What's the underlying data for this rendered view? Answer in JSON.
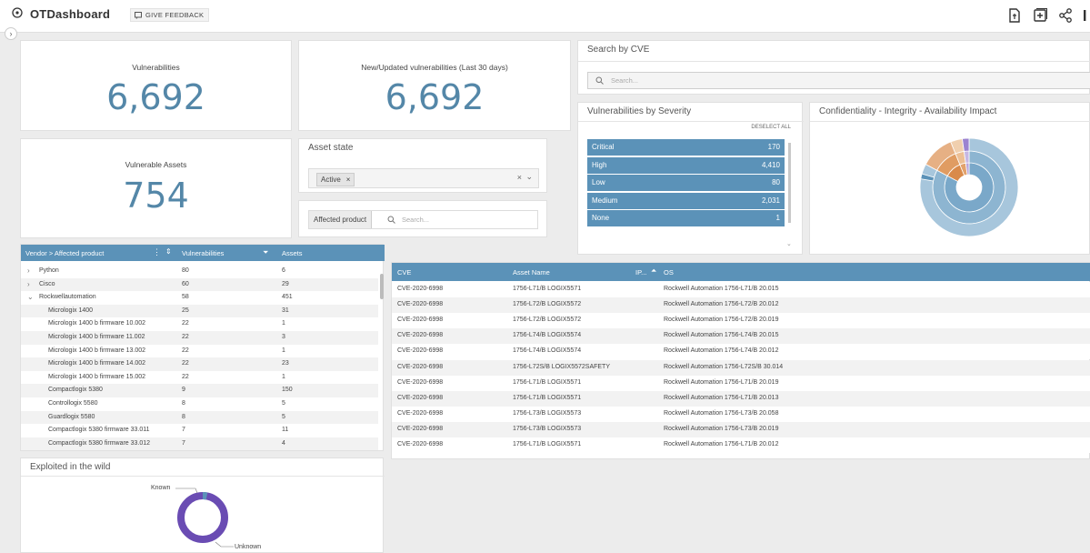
{
  "app": {
    "title": "OTDashboard",
    "feedback_label": "GIVE FEEDBACK"
  },
  "kpis": {
    "vulnerabilities": {
      "label": "Vulnerabilities",
      "value": "6,692"
    },
    "new_updated": {
      "label": "New/Updated vulnerabilities (Last 30 days)",
      "value": "6,692"
    },
    "vulnerable_assets": {
      "label": "Vulnerable Assets",
      "value": "754"
    }
  },
  "asset_state": {
    "title": "Asset state",
    "chip": "Active"
  },
  "affected_product": {
    "label": "Affected product",
    "placeholder": "Search..."
  },
  "search_cve": {
    "title": "Search by CVE",
    "placeholder": "Search..."
  },
  "severity": {
    "title": "Vulnerabilities by Severity",
    "deselect": "DESELECT ALL",
    "rows": [
      {
        "label": "Critical",
        "count": "170"
      },
      {
        "label": "High",
        "count": "4,410"
      },
      {
        "label": "Low",
        "count": "80"
      },
      {
        "label": "Medium",
        "count": "2,031"
      },
      {
        "label": "None",
        "count": "1"
      }
    ]
  },
  "cia": {
    "title": "Confidentiality - Integrity - Availability Impact"
  },
  "vendor_table": {
    "headers": {
      "vendor": "Vendor > Affected product",
      "vulns": "Vulnerabilities",
      "assets": "Assets"
    },
    "rows": [
      {
        "indent": 0,
        "toggle": "›",
        "name": "Python",
        "vulns": "80",
        "assets": "6"
      },
      {
        "indent": 0,
        "toggle": "›",
        "name": "Cisco",
        "vulns": "60",
        "assets": "29"
      },
      {
        "indent": 0,
        "toggle": "⌄",
        "name": "Rockwellautomation",
        "vulns": "58",
        "assets": "451"
      },
      {
        "indent": 1,
        "toggle": "",
        "name": "Micrologix 1400",
        "vulns": "25",
        "assets": "31"
      },
      {
        "indent": 1,
        "toggle": "",
        "name": "Micrologix 1400 b firmware 10.002",
        "vulns": "22",
        "assets": "1"
      },
      {
        "indent": 1,
        "toggle": "",
        "name": "Micrologix 1400 b firmware 11.002",
        "vulns": "22",
        "assets": "3"
      },
      {
        "indent": 1,
        "toggle": "",
        "name": "Micrologix 1400 b firmware 13.002",
        "vulns": "22",
        "assets": "1"
      },
      {
        "indent": 1,
        "toggle": "",
        "name": "Micrologix 1400 b firmware 14.002",
        "vulns": "22",
        "assets": "23"
      },
      {
        "indent": 1,
        "toggle": "",
        "name": "Micrologix 1400 b firmware 15.002",
        "vulns": "22",
        "assets": "1"
      },
      {
        "indent": 1,
        "toggle": "",
        "name": "Compactlogix 5380",
        "vulns": "9",
        "assets": "150"
      },
      {
        "indent": 1,
        "toggle": "",
        "name": "Controllogix 5580",
        "vulns": "8",
        "assets": "5"
      },
      {
        "indent": 1,
        "toggle": "",
        "name": "Guardlogix 5580",
        "vulns": "8",
        "assets": "5"
      },
      {
        "indent": 1,
        "toggle": "",
        "name": "Compactlogix 5380 firmware 33.011",
        "vulns": "7",
        "assets": "11"
      },
      {
        "indent": 1,
        "toggle": "",
        "name": "Compactlogix 5380 firmware 33.012",
        "vulns": "7",
        "assets": "4"
      }
    ]
  },
  "exploited": {
    "title": "Exploited in the wild",
    "known": "Known",
    "unknown": "Unknown",
    "known_fraction": 0.03
  },
  "cve_table": {
    "headers": {
      "cve": "CVE",
      "asset": "Asset Name",
      "ip": "IP...",
      "os": "OS"
    },
    "rows": [
      {
        "cve": "CVE-2020-6998",
        "asset": "1756-L71/B LOGIX5571",
        "os": "Rockwell Automation 1756-L71/B 20.015"
      },
      {
        "cve": "CVE-2020-6998",
        "asset": "1756-L72/B LOGIX5572",
        "os": "Rockwell Automation 1756-L72/B 20.012"
      },
      {
        "cve": "CVE-2020-6998",
        "asset": "1756-L72/B LOGIX5572",
        "os": "Rockwell Automation 1756-L72/B 20.019"
      },
      {
        "cve": "CVE-2020-6998",
        "asset": "1756-L74/B LOGIX5574",
        "os": "Rockwell Automation 1756-L74/B 20.015"
      },
      {
        "cve": "CVE-2020-6998",
        "asset": "1756-L74/B LOGIX5574",
        "os": "Rockwell Automation 1756-L74/B 20.012"
      },
      {
        "cve": "CVE-2020-6998",
        "asset": "1756-L72S/B LOGIX5572SAFETY",
        "os": "Rockwell Automation 1756-L72S/B 30.014"
      },
      {
        "cve": "CVE-2020-6998",
        "asset": "1756-L71/B LOGIX5571",
        "os": "Rockwell Automation 1756-L71/B 20.019"
      },
      {
        "cve": "CVE-2020-6998",
        "asset": "1756-L71/B LOGIX5571",
        "os": "Rockwell Automation 1756-L71/B 20.013"
      },
      {
        "cve": "CVE-2020-6998",
        "asset": "1756-L73/B LOGIX5573",
        "os": "Rockwell Automation 1756-L73/B 20.058"
      },
      {
        "cve": "CVE-2020-6998",
        "asset": "1756-L73/B LOGIX5573",
        "os": "Rockwell Automation 1756-L73/B 20.019"
      },
      {
        "cve": "CVE-2020-6998",
        "asset": "1756-L71/B LOGIX5571",
        "os": "Rockwell Automation 1756-L71/B 20.012"
      }
    ]
  },
  "colors": {
    "accent": "#5b92b8",
    "kpi": "#5487a8",
    "donut": "#6a4cb3",
    "known": "#5b92b8",
    "orange": "#d98a4a"
  }
}
